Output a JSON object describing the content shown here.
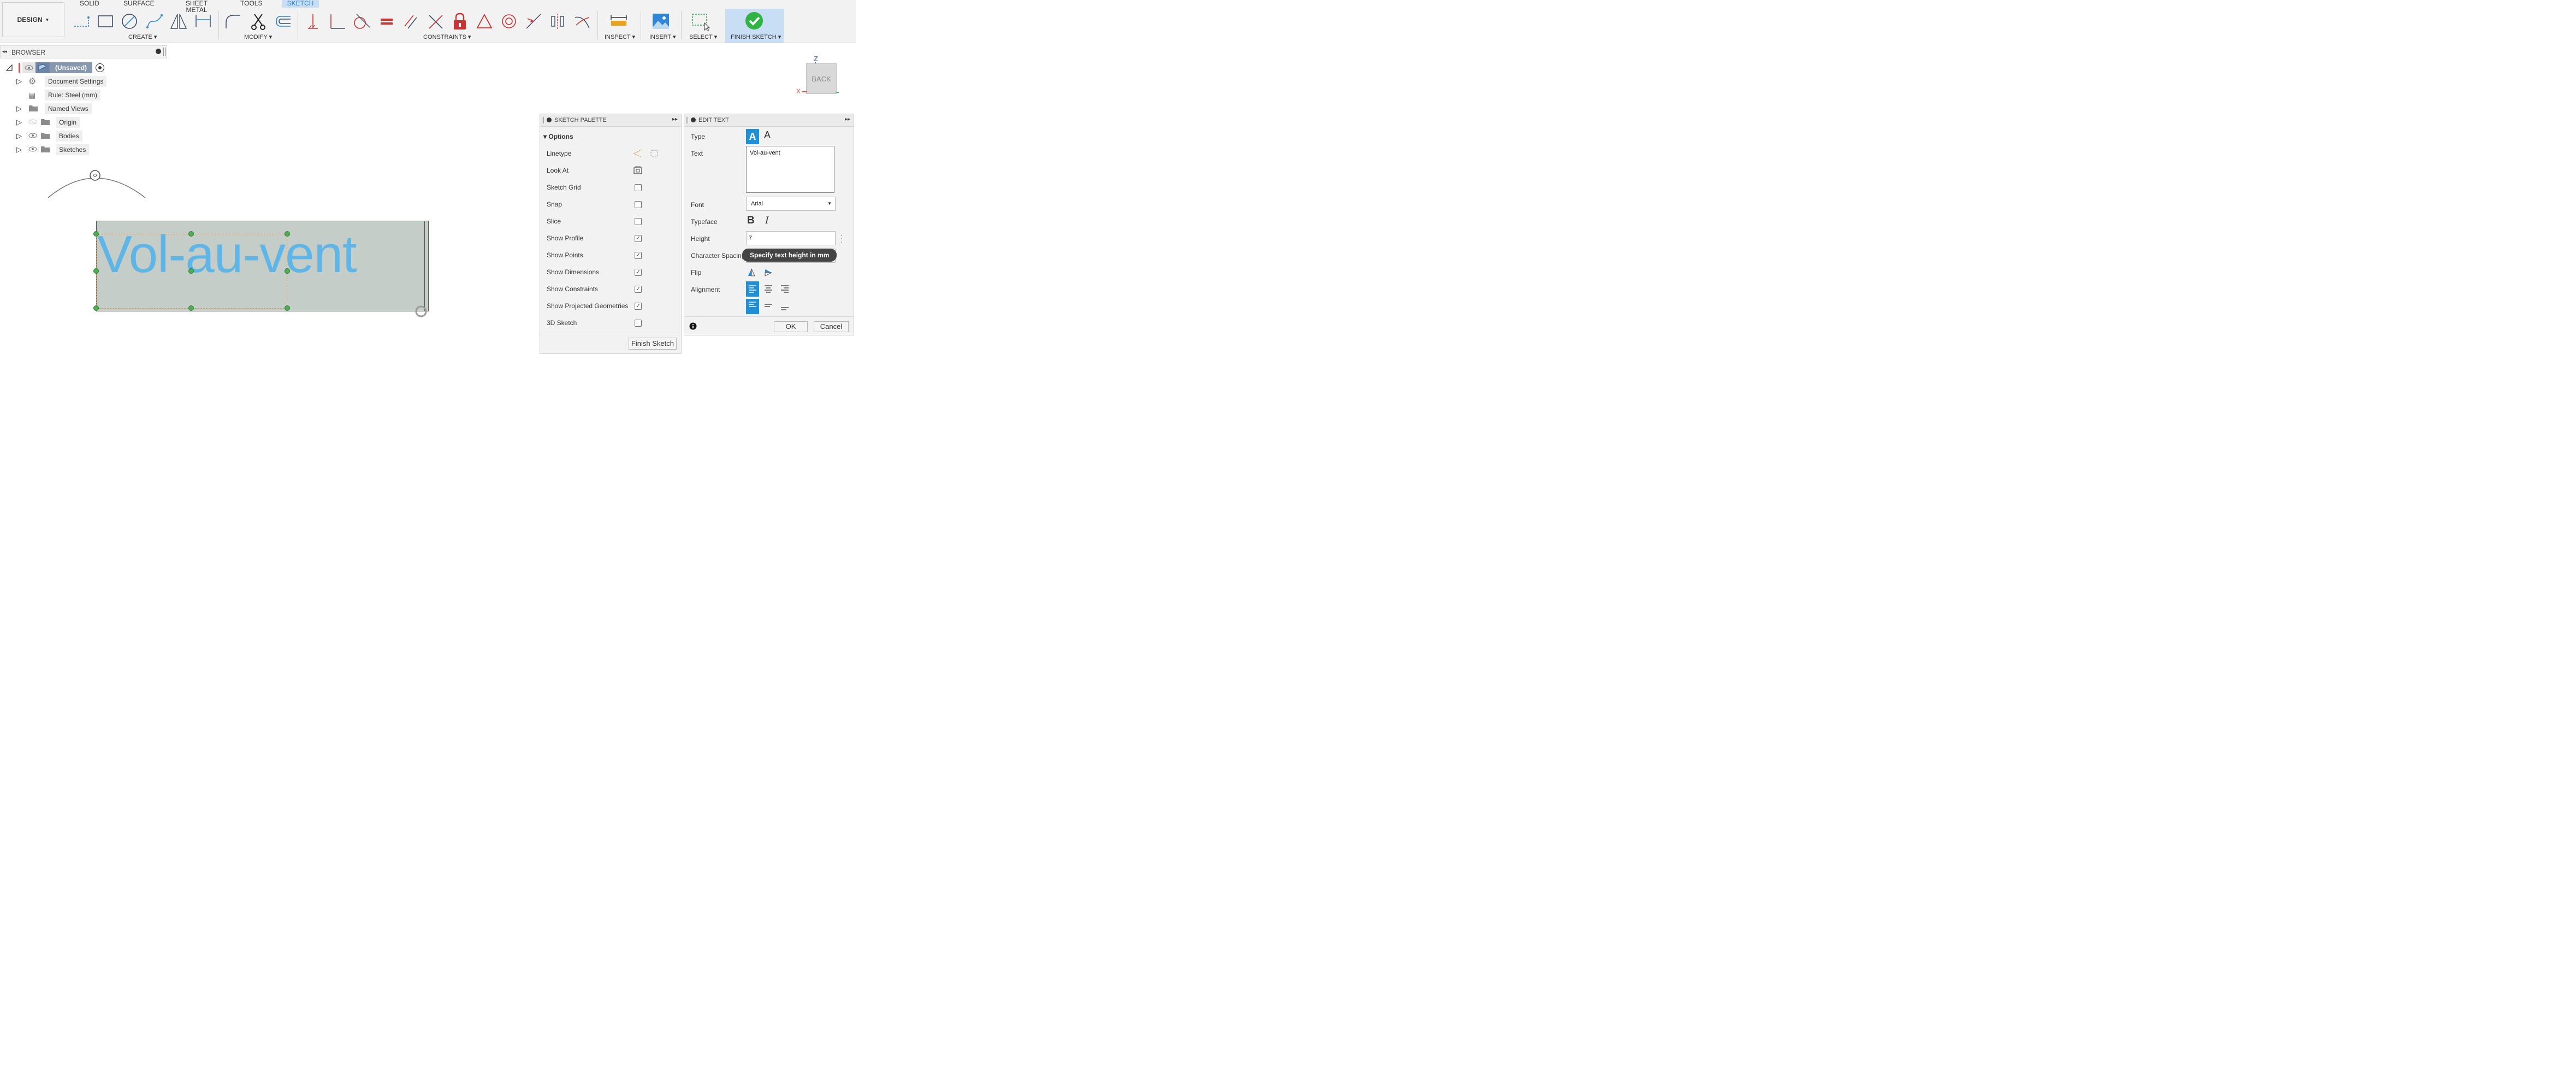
{
  "toolbar": {
    "workspace_button": "DESIGN",
    "tabs": [
      "SOLID",
      "SURFACE",
      "SHEET METAL",
      "TOOLS",
      "SKETCH"
    ],
    "groups": {
      "create": "CREATE",
      "modify": "MODIFY",
      "constraints": "CONSTRAINTS",
      "inspect": "INSPECT",
      "insert": "INSERT",
      "select": "SELECT",
      "finish": "FINISH SKETCH"
    },
    "accent_color": "#2f86d6"
  },
  "browser": {
    "title": "BROWSER",
    "root": "(Unsaved)",
    "items": [
      "Document Settings",
      "Rule: Steel (mm)",
      "Named Views",
      "Origin",
      "Bodies",
      "Sketches"
    ]
  },
  "viewcube": {
    "face": "BACK",
    "axis_z": "Z",
    "axis_x": "X"
  },
  "canvas": {
    "sketch_text": "Vol-au-vent",
    "text_color": "#5fb6e6"
  },
  "sketch_palette": {
    "title": "SKETCH PALETTE",
    "section": "Options",
    "linetype_label": "Linetype",
    "look_at_label": "Look At",
    "options": [
      {
        "label": "Sketch Grid",
        "checked": false
      },
      {
        "label": "Snap",
        "checked": false
      },
      {
        "label": "Slice",
        "checked": false
      },
      {
        "label": "Show Profile",
        "checked": true
      },
      {
        "label": "Show Points",
        "checked": true
      },
      {
        "label": "Show Dimensions",
        "checked": true
      },
      {
        "label": "Show Constraints",
        "checked": true
      },
      {
        "label": "Show Projected Geometries",
        "checked": true
      },
      {
        "label": "3D Sketch",
        "checked": false
      }
    ],
    "finish_button": "Finish Sketch"
  },
  "edit_text": {
    "title": "EDIT TEXT",
    "labels": {
      "type": "Type",
      "text": "Text",
      "font": "Font",
      "typeface": "Typeface",
      "height": "Height",
      "char_spacing": "Character Spacing",
      "flip": "Flip",
      "alignment": "Alignment"
    },
    "text_value": "Vol-au-vent",
    "font_value": "Arial",
    "height_value": "7",
    "tooltip": "Specify text height in mm",
    "ok": "OK",
    "cancel": "Cancel"
  }
}
